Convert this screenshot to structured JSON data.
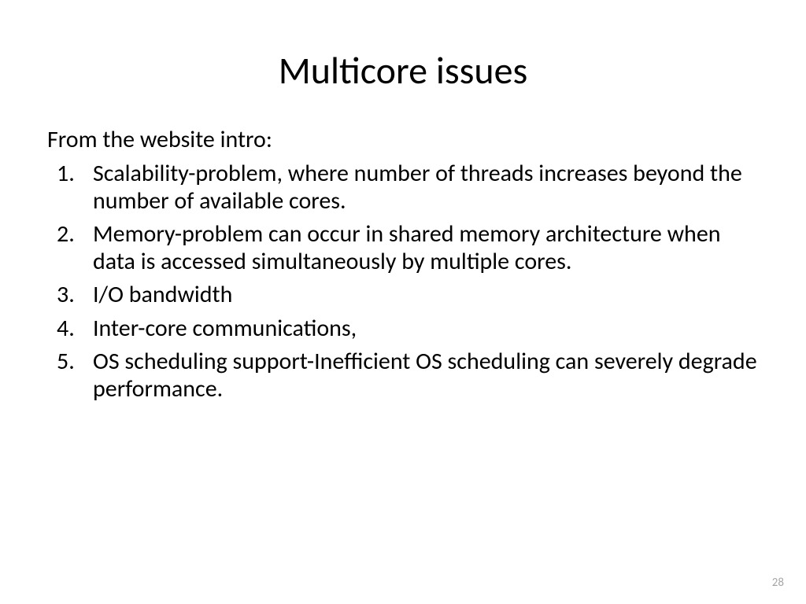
{
  "slide": {
    "title": "Multicore issues",
    "intro": "From the website intro:",
    "items": [
      "Scalability-problem, where number of threads increases beyond the number of available cores.",
      "Memory-problem can occur in shared memory architecture when data is accessed simultaneously by multiple cores.",
      "I/O bandwidth",
      "Inter-core communications,",
      "OS scheduling support-Inefficient OS scheduling can severely degrade performance."
    ],
    "page_number": "28"
  }
}
